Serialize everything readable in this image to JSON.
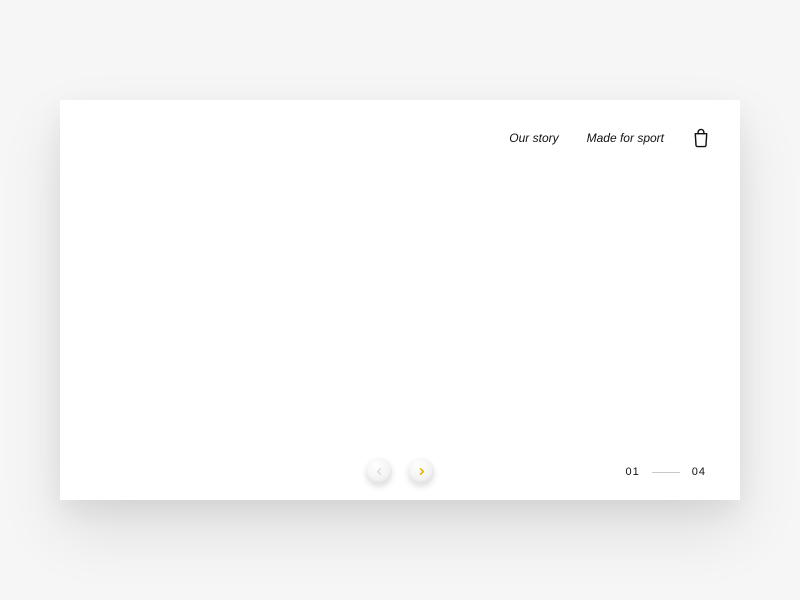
{
  "nav": {
    "links": [
      {
        "label": "Our story"
      },
      {
        "label": "Made for sport"
      }
    ]
  },
  "pager": {
    "current": "01",
    "total": "04"
  }
}
